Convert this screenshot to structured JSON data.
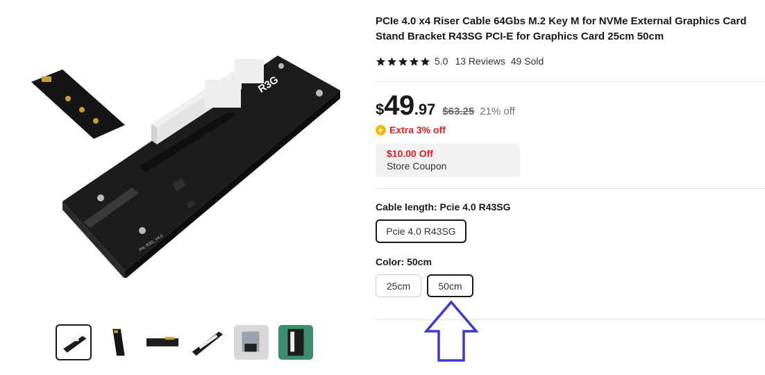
{
  "product": {
    "title": "PCIe 4.0 x4 Riser Cable 64Gbs M.2 Key M for NVMe External Graphics Card Stand Bracket R43SG PCI-E for Graphics Card 25cm 50cm",
    "rating": {
      "stars": 5,
      "score": "5.0",
      "reviews": "13 Reviews",
      "sold": "49 Sold"
    },
    "price": {
      "currency": "$",
      "integer": "49",
      "decimal": ".97",
      "original": "$63.25",
      "discount": "21% off",
      "extra": "Extra 3% off"
    },
    "coupon": {
      "amount": "$10.00 Off",
      "label": "Store Coupon"
    },
    "cable_length": {
      "label": "Cable length: Pcie 4.0 R43SG",
      "options": [
        "Pcie 4.0 R43SG"
      ],
      "selected": "Pcie 4.0 R43SG"
    },
    "color": {
      "label": "Color: 50cm",
      "options": [
        "25cm",
        "50cm"
      ],
      "selected": "50cm"
    }
  },
  "board": {
    "silk_label": "R3G",
    "pn_label": "PN: R3G_V4.0"
  },
  "colors": {
    "accent_red": "#e02020",
    "text": "#191919",
    "arrow": "#3a3ad0",
    "board": "#1c1c1c"
  }
}
